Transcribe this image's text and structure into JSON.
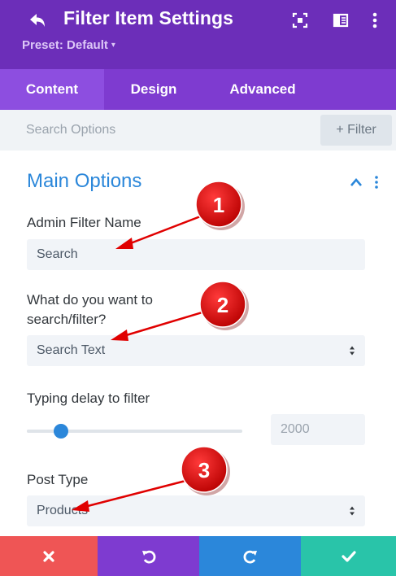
{
  "header": {
    "title": "Filter Item Settings",
    "preset_label": "Preset: Default",
    "preset_caret": "▾",
    "icons": [
      "back-icon",
      "focus-mode-icon",
      "split-view-icon",
      "more-options-icon"
    ],
    "background": "#6c2eb9"
  },
  "tabs": [
    {
      "label": "Content",
      "active": true
    },
    {
      "label": "Design",
      "active": false
    },
    {
      "label": "Advanced",
      "active": false
    }
  ],
  "search": {
    "placeholder": "Search Options",
    "filter_label": "+ Filter"
  },
  "section": {
    "title": "Main Options",
    "accent": "#2b87da"
  },
  "fields": {
    "admin_filter_name": {
      "label": "Admin Filter Name",
      "value": "Search"
    },
    "search_filter": {
      "label_line1": "What do you want to",
      "label_line2": "search/filter?",
      "value": "Search Text"
    },
    "typing_delay": {
      "label": "Typing delay to filter",
      "value": "2000",
      "level_fraction": 0.16
    },
    "post_type": {
      "label": "Post Type",
      "value": "Products"
    }
  },
  "annotations": [
    {
      "number": "1"
    },
    {
      "number": "2"
    },
    {
      "number": "3"
    }
  ],
  "footer": {
    "buttons": [
      {
        "name": "cancel",
        "icon": "close-icon",
        "color": "#ef5555"
      },
      {
        "name": "undo",
        "icon": "undo-icon",
        "color": "#7e3bd0"
      },
      {
        "name": "redo",
        "icon": "redo-icon",
        "color": "#2b87da"
      },
      {
        "name": "save",
        "icon": "check-icon",
        "color": "#29c4a9"
      }
    ]
  }
}
